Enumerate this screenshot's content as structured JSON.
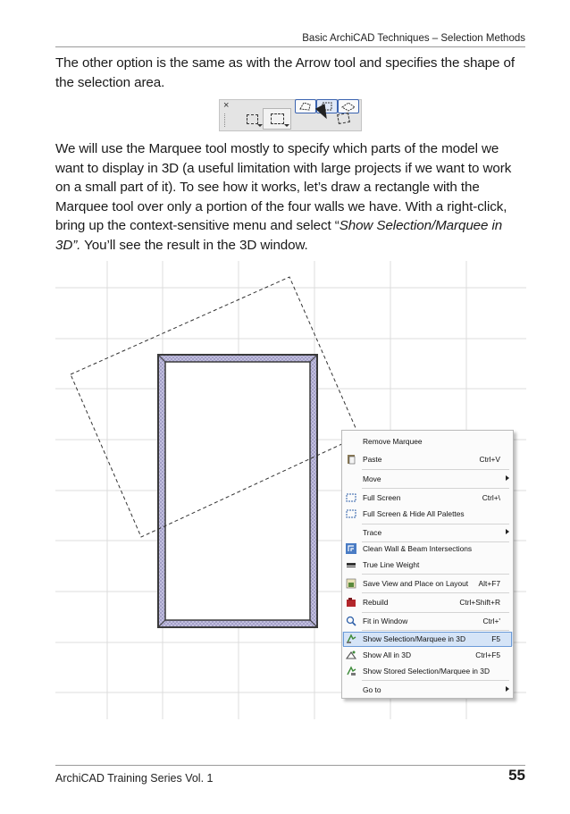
{
  "header": {
    "running_title": "Basic ArchiCAD Techniques – Selection Methods"
  },
  "intro": {
    "text": "The other option is the same as with the Arrow tool and specifies the shape of the selection area."
  },
  "body": {
    "text_before": "We will use the Marquee tool mostly to specify which parts of the model we want to display in 3D (a useful limitation with large projects if we want to work on a small part of it). To see how it works, let’s draw a rectangle with the Marquee tool over only a portion of the four walls we have. With a right-click, bring up the context-sensitive menu and select “",
    "text_italic": "Show Selection/Marquee in 3D”.",
    "text_after": " You’ll see the result in the 3D window."
  },
  "toolbar": {
    "close_glyph": "×",
    "icons": [
      "marquee-rectangle-icon",
      "marquee-rectangle-pressed-icon",
      "marquee-polygon-icon",
      "marquee-rotated-rectangle-icon",
      "marquee-single-floor-icon"
    ]
  },
  "context_menu": {
    "items": [
      {
        "label": "Remove Marquee",
        "shortcut": "",
        "icon": "",
        "submenu": false
      },
      {
        "label": "Paste",
        "shortcut": "Ctrl+V",
        "icon": "paste-icon",
        "submenu": false
      },
      {
        "label": "Move",
        "shortcut": "",
        "icon": "",
        "submenu": true
      },
      {
        "label": "Full Screen",
        "shortcut": "Ctrl+\\",
        "icon": "full-screen-icon",
        "submenu": false
      },
      {
        "label": "Full Screen & Hide All Palettes",
        "shortcut": "",
        "icon": "full-screen-hide-palettes-icon",
        "submenu": false
      },
      {
        "label": "Trace",
        "shortcut": "",
        "icon": "",
        "submenu": true
      },
      {
        "label": "Clean Wall & Beam Intersections",
        "shortcut": "",
        "icon": "clean-intersections-icon",
        "submenu": false
      },
      {
        "label": "True Line Weight",
        "shortcut": "",
        "icon": "true-line-weight-icon",
        "submenu": false
      },
      {
        "label": "Save View and Place on Layout",
        "shortcut": "Alt+F7",
        "icon": "save-view-icon",
        "submenu": false
      },
      {
        "label": "Rebuild",
        "shortcut": "Ctrl+Shift+R",
        "icon": "rebuild-icon",
        "submenu": false
      },
      {
        "label": "Fit in Window",
        "shortcut": "Ctrl+'",
        "icon": "fit-in-window-icon",
        "submenu": false
      },
      {
        "label": "Show Selection/Marquee in 3D",
        "shortcut": "F5",
        "icon": "show-selection-3d-icon",
        "submenu": false,
        "highlighted": true
      },
      {
        "label": "Show All in 3D",
        "shortcut": "Ctrl+F5",
        "icon": "show-all-3d-icon",
        "submenu": false
      },
      {
        "label": "Show Stored Selection/Marquee in 3D",
        "shortcut": "",
        "icon": "show-stored-selection-3d-icon",
        "submenu": false
      },
      {
        "label": "Go to",
        "shortcut": "",
        "icon": "",
        "submenu": true
      }
    ]
  },
  "footer": {
    "series": "ArchiCAD Training Series Vol. 1",
    "page_number": "55"
  },
  "colors": {
    "highlight": "#d5e4f7",
    "highlight_border": "#6b9bd8",
    "wall_fill": "#b9b6d8",
    "grid": "#dcdcdc"
  }
}
